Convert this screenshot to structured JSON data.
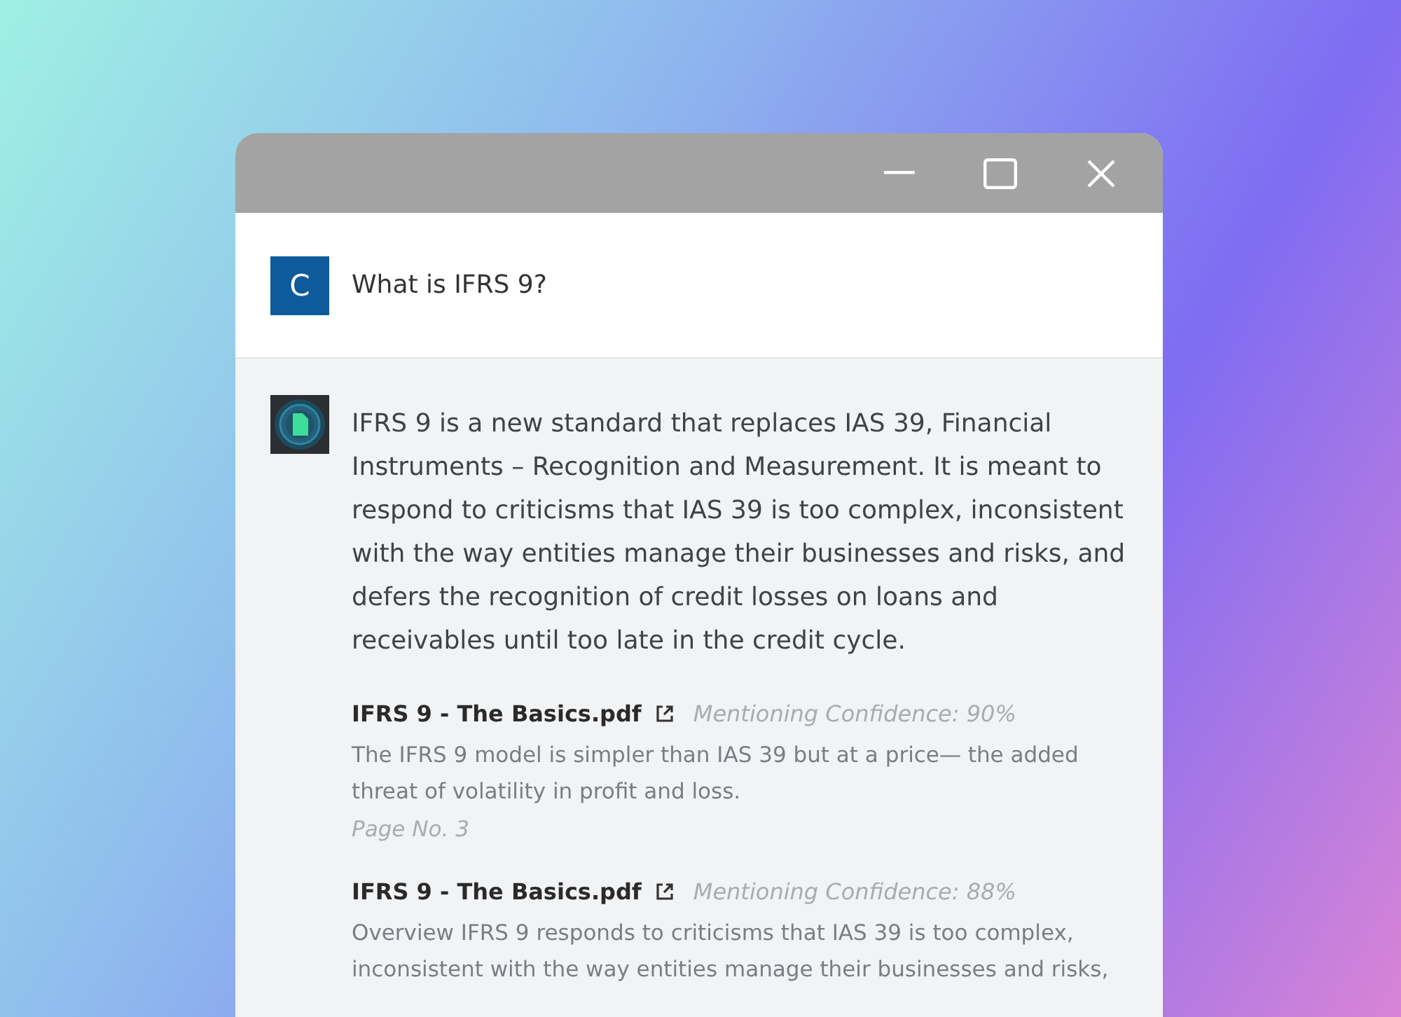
{
  "window": {
    "controls": [
      {
        "kind": "minimize"
      },
      {
        "kind": "maximize"
      },
      {
        "kind": "close"
      }
    ]
  },
  "question": {
    "avatar": "C",
    "text": "What is IFRS 9?"
  },
  "answer": {
    "text": "IFRS 9 is a new standard that replaces IAS 39, Financial Instruments – Recognition and Measurement. It is meant to respond to criticisms that IAS 39 is too complex, inconsistent with the way entities manage their businesses and risks, and defers the recognition of credit losses on loans and receivables until too late in the credit cycle.",
    "sources": [
      {
        "file": "IFRS 9 - The Basics.pdf",
        "confidence": "Mentioning Confidence: 90%",
        "snippet": "The IFRS 9 model is simpler than IAS 39 but at a price— the added threat of volatility in profit and loss.",
        "page": "Page No. 3"
      },
      {
        "file": "IFRS 9 - The Basics.pdf",
        "confidence": "Mentioning Confidence: 88%",
        "snippet": "Overview IFRS 9 responds to criticisms that IAS 39 is too complex, inconsistent with the way entities manage their businesses and risks,"
      }
    ]
  }
}
